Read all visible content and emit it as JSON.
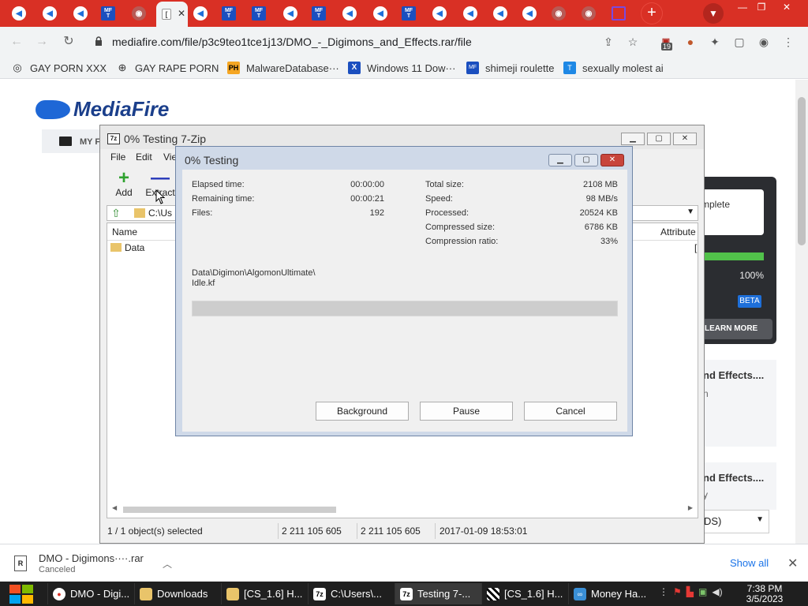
{
  "browser": {
    "active_tab_favicon": "[",
    "active_tab_close": "✕",
    "new_tab": "+",
    "tab_search": "▼",
    "window_min": "—",
    "window_restore": "❐",
    "window_close": "✕",
    "url": "mediafire.com/file/p3c9teo1tce1j13/DMO_-_Digimons_and_Effects.rar/file",
    "extension_badge": "19"
  },
  "bookmarks": [
    {
      "label": "GAY PORN XXX",
      "icon": "github-icon"
    },
    {
      "label": "GAY RAPE PORN",
      "icon": "globe-icon"
    },
    {
      "label": "MalwareDatabase···",
      "icon": "ph-icon"
    },
    {
      "label": "Windows 11 Dow···",
      "icon": "x-icon"
    },
    {
      "label": "shimeji roulette",
      "icon": "mf-icon"
    },
    {
      "label": "sexually molest ai",
      "icon": "t-icon"
    }
  ],
  "mediafire": {
    "logo": "MediaFire",
    "my_files": "MY F",
    "panel_complete": "mplete",
    "panel_percent": "100%",
    "panel_beta": "BETA",
    "panel_learn": "LEARN MORE",
    "card1_title": "nd Effects....",
    "card1_sub": "n",
    "card2_title": "nd Effects....",
    "card2_sub": "y",
    "select_value": "DS)"
  },
  "zip": {
    "title": "0% Testing 7-Zip",
    "title_icon": "7z",
    "menu": [
      "File",
      "Edit",
      "Vie"
    ],
    "tools": [
      {
        "label": "Add",
        "glyph": "+"
      },
      {
        "label": "Extract",
        "glyph": "—"
      }
    ],
    "path": "C:\\Us",
    "columns": {
      "name": "Name",
      "attributes": "Attribute"
    },
    "row_name": "Data",
    "row_attr": "[",
    "status": {
      "selected": "1 / 1 object(s) selected",
      "size": "2 211 105 605",
      "packed": "2 211 105 605",
      "modified": "2017-01-09 18:53:01"
    }
  },
  "dialog": {
    "title": "0% Testing",
    "left": [
      {
        "label": "Elapsed time:",
        "value": "00:00:00"
      },
      {
        "label": "Remaining time:",
        "value": "00:00:21"
      },
      {
        "label": "Files:",
        "value": "192"
      }
    ],
    "right": [
      {
        "label": "Total size:",
        "value": "2108 MB"
      },
      {
        "label": "Speed:",
        "value": "98 MB/s"
      },
      {
        "label": "Processed:",
        "value": "20524 KB"
      },
      {
        "label": "Compressed size:",
        "value": "6786 KB"
      },
      {
        "label": "Compression ratio:",
        "value": "33%"
      }
    ],
    "current_file_line1": "Data\\Digimon\\AlgomonUltimate\\",
    "current_file_line2": "Idle.kf",
    "progress_fraction": 0,
    "buttons": {
      "background": "Background",
      "pause": "Pause",
      "cancel": "Cancel"
    }
  },
  "download": {
    "name": "DMO - Digimons····.rar",
    "status": "Canceled",
    "show_all": "Show all"
  },
  "taskbar": {
    "items": [
      {
        "label": "DMO - Digi...",
        "icon": "chrome-icon"
      },
      {
        "label": "Downloads",
        "icon": "folder-icon"
      },
      {
        "label": "[CS_1.6] H...",
        "icon": "folder-icon"
      },
      {
        "label": "C:\\Users\\...",
        "icon": "7zip-icon"
      },
      {
        "label": "Testing 7-...",
        "icon": "7zip-icon"
      },
      {
        "label": "[CS_1.6] H...",
        "icon": "checker-icon"
      },
      {
        "label": "Money Ha...",
        "icon": "vs-icon"
      }
    ],
    "time": "7:38 PM",
    "date": "3/5/2023"
  },
  "colors": {
    "tabstrip": "#d93025",
    "mediafire_blue": "#1b3f8b",
    "progress_green": "#06b025",
    "taskbar": "#1f1f1f"
  }
}
